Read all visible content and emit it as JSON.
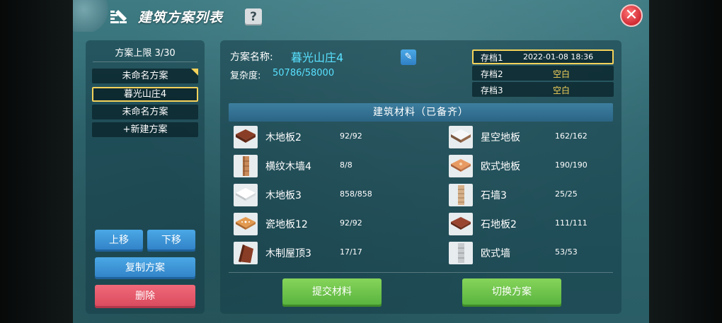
{
  "header": {
    "title": "建筑方案列表",
    "help": "?",
    "close": "✕"
  },
  "left": {
    "limit": "方案上限 3/30",
    "plans": [
      "未命名方案",
      "暮光山庄4",
      "未命名方案"
    ],
    "new_plan": "+新建方案",
    "move_up": "上移",
    "move_down": "下移",
    "copy": "复制方案",
    "delete": "删除"
  },
  "plan": {
    "name_label": "方案名称:",
    "name": "暮光山庄4",
    "complexity_label": "复杂度:",
    "complexity": "50786/58000"
  },
  "saves": [
    {
      "name": "存档1",
      "value": "2022-01-08 18:36"
    },
    {
      "name": "存档2",
      "value": "空白"
    },
    {
      "name": "存档3",
      "value": "空白"
    }
  ],
  "materials_header": "建筑材料（已备齐）",
  "materials_left": [
    {
      "name": "木地板2",
      "count": "92/92"
    },
    {
      "name": "横纹木墙4",
      "count": "8/8"
    },
    {
      "name": "木地板3",
      "count": "858/858"
    },
    {
      "name": "瓷地板12",
      "count": "92/92"
    },
    {
      "name": "木制屋顶3",
      "count": "17/17"
    }
  ],
  "materials_right": [
    {
      "name": "星空地板",
      "count": "162/162"
    },
    {
      "name": "欧式地板",
      "count": "190/190"
    },
    {
      "name": "石墙3",
      "count": "25/25"
    },
    {
      "name": "石地板2",
      "count": "111/111"
    },
    {
      "name": "欧式墙",
      "count": "53/53"
    }
  ],
  "actions": {
    "submit": "提交材料",
    "switch": "切换方案"
  },
  "colors": {
    "accent": "#59e1ff",
    "highlight": "#f4d25a",
    "danger": "#d8485c",
    "ok": "#56b23d"
  }
}
